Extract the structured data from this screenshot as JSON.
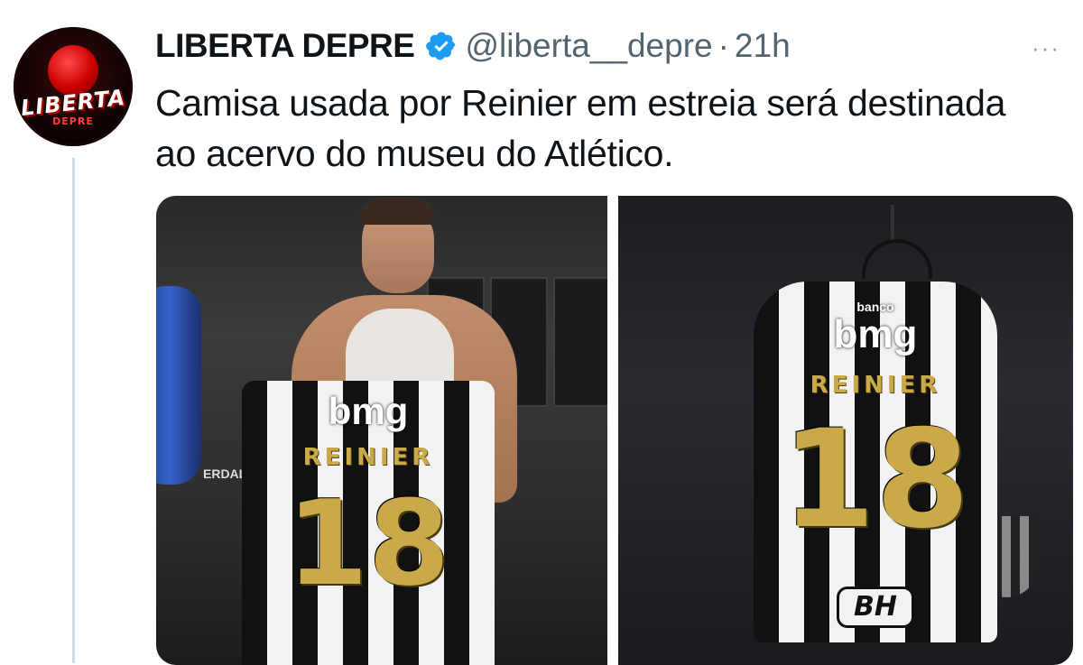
{
  "tweet": {
    "author_name": "LIBERTA DEPRE",
    "handle": "@liberta__depre",
    "separator": "·",
    "time": "21h",
    "more_label": "···",
    "text": "Camisa usada por Reinier em estreia será destinada ao acervo do museu do Atlético.",
    "avatar": {
      "logo_text": "LIBERTA",
      "logo_sub": "DEPRE"
    },
    "verified_color": "#1d9bf0"
  },
  "media": {
    "left_photo": {
      "sponsor": "bmg",
      "player_name": "REINIER",
      "number": "18",
      "bg_text": "ERDAL"
    },
    "right_photo": {
      "sponsor_small": "banco",
      "sponsor": "bmg",
      "player_name": "REINIER",
      "number": "18",
      "badge": "BH"
    }
  }
}
